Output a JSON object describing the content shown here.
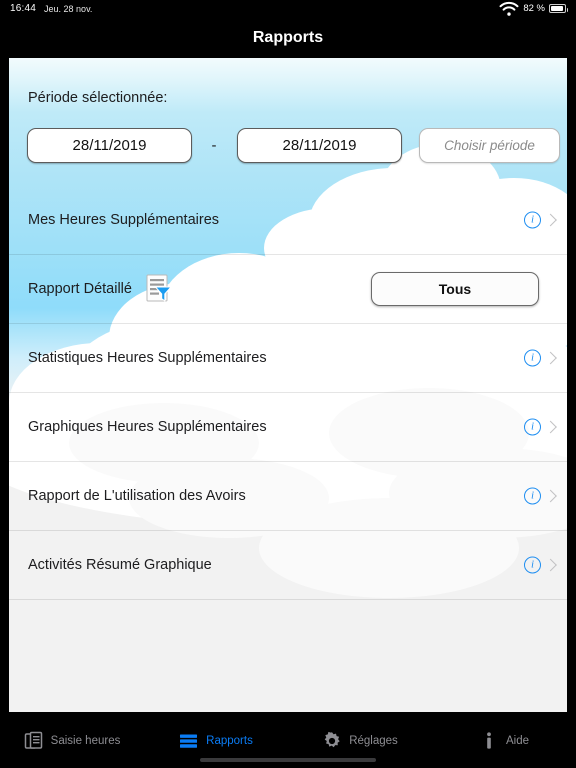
{
  "status_bar": {
    "time": "16:44",
    "date": "Jeu. 28 nov.",
    "battery_percent": "82 %",
    "wifi_icon": "wifi-icon",
    "battery_icon": "battery-icon"
  },
  "nav": {
    "title": "Rapports"
  },
  "period": {
    "label": "Période sélectionnée:",
    "start_date": "28/11/2019",
    "separator": "-",
    "end_date": "28/11/2019",
    "choose_button": "Choisir période"
  },
  "list": {
    "rows": [
      {
        "label": "Mes Heures Supplémentaires",
        "info_icon": "info-icon",
        "chevron": "chevron-right-icon"
      },
      {
        "label": "Rapport Détaillé",
        "filter_icon": "document-filter-icon",
        "button": "Tous"
      },
      {
        "label": "Statistiques Heures Supplémentaires",
        "info_icon": "info-icon",
        "chevron": "chevron-right-icon"
      },
      {
        "label": "Graphiques Heures Supplémentaires",
        "info_icon": "info-icon",
        "chevron": "chevron-right-icon"
      },
      {
        "label": "Rapport de L'utilisation des Avoirs",
        "info_icon": "info-icon",
        "chevron": "chevron-right-icon"
      },
      {
        "label": "Activités Résumé Graphique",
        "info_icon": "info-icon",
        "chevron": "chevron-right-icon"
      }
    ],
    "info_glyph": "i"
  },
  "tab_bar": {
    "items": [
      {
        "label": "Saisie heures",
        "icon": "documents-icon",
        "active": false
      },
      {
        "label": "Rapports",
        "icon": "report-bars-icon",
        "active": true
      },
      {
        "label": "Réglages",
        "icon": "gear-icon",
        "active": false
      },
      {
        "label": "Aide",
        "icon": "info-i-icon",
        "active": false
      }
    ]
  },
  "colors": {
    "accent_blue": "#0a7cf5",
    "info_blue": "#1e8ef1",
    "sky_blue": "#8fdcfa",
    "tab_inactive": "#8e8e93",
    "background": "#000000",
    "card_background": "#f2f2f2"
  }
}
